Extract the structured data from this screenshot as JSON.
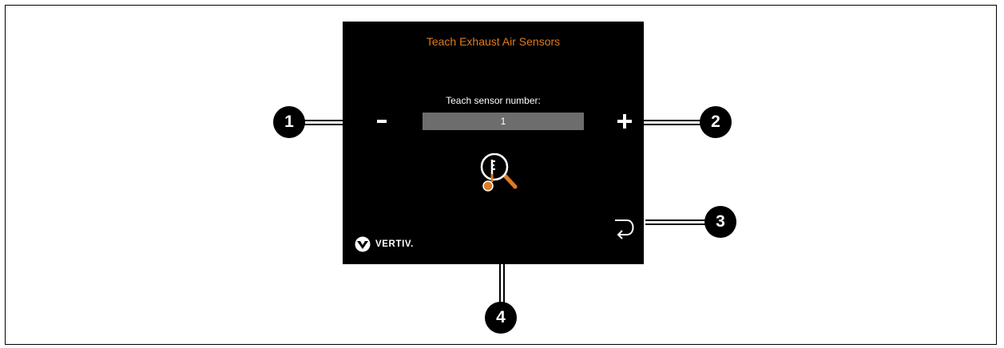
{
  "screen": {
    "title": "Teach Exhaust Air Sensors",
    "sensor_label": "Teach sensor number:",
    "sensor_value": "1",
    "logo_text": "VERTIV."
  },
  "controls": {
    "decrease_icon": "minus-icon",
    "increase_icon": "plus-icon",
    "teach_icon": "sensor-search-icon",
    "back_icon": "return-arrow-icon"
  },
  "callouts": [
    "1",
    "2",
    "3",
    "4"
  ],
  "colors": {
    "screen_bg": "#000000",
    "title": "#e07b1f",
    "icon_accent": "#e07b1f",
    "field_bg": "#6d6d6d",
    "text": "#ffffff"
  }
}
